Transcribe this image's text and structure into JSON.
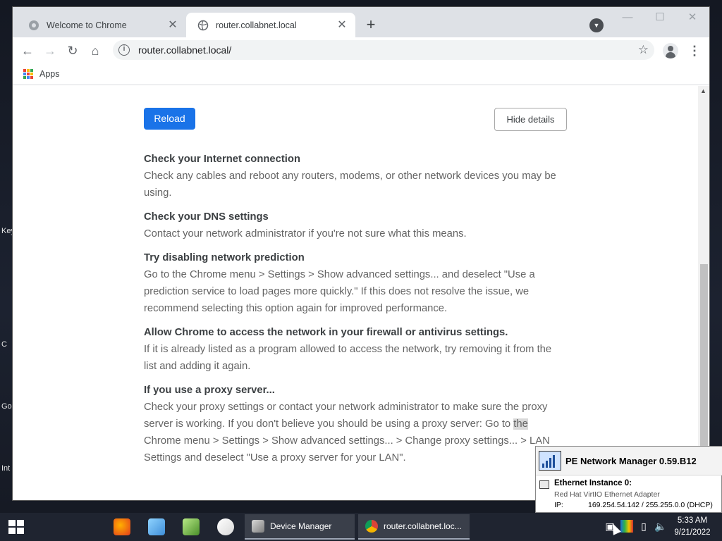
{
  "desktop": {
    "labels": [
      "Key",
      "C",
      "Go",
      "Int"
    ]
  },
  "browser": {
    "tabs": [
      {
        "label": "Welcome to Chrome",
        "active": false
      },
      {
        "label": "router.collabnet.local",
        "active": true
      }
    ],
    "address": "router.collabnet.local/",
    "bookmarks": {
      "apps_label": "Apps"
    }
  },
  "page": {
    "reload_label": "Reload",
    "hide_details_label": "Hide details",
    "suggestions": [
      {
        "heading": "Check your Internet connection",
        "body": "Check any cables and reboot any routers, modems, or other network devices you may be using."
      },
      {
        "heading": "Check your DNS settings",
        "body": "Contact your network administrator if you're not sure what this means."
      },
      {
        "heading": "Try disabling network prediction",
        "body": "Go to the Chrome menu > Settings > Show advanced settings... and deselect \"Use a prediction service to load pages more quickly.\" If this does not resolve the issue, we recommend selecting this option again for improved performance."
      },
      {
        "heading": "Allow Chrome to access the network in your firewall or antivirus settings.",
        "body": "If it is already listed as a program allowed to access the network, try removing it from the list and adding it again."
      },
      {
        "heading": "If you use a proxy server...",
        "body_before": "Check your proxy settings or contact your network administrator to make sure the proxy server is working. If you don't believe you should be using a proxy server: Go to ",
        "body_highlight": "the",
        "body_after": " Chrome menu > Settings > Show advanced settings... > Change proxy settings... > LAN Settings and deselect \"Use a proxy server for your LAN\"."
      }
    ]
  },
  "network_popup": {
    "title": "PE Network Manager 0.59.B12",
    "instance": "Ethernet Instance 0:",
    "adapter": "Red Hat VirtIO Ethernet Adapter",
    "ip_label": "IP:",
    "ip_value": "169.254.54.142  /  255.255.0.0 (DHCP)"
  },
  "taskbar": {
    "tasks": [
      {
        "label": "Device Manager"
      },
      {
        "label": "router.collabnet.loc..."
      }
    ],
    "time": "5:33 AM",
    "date": "9/21/2022"
  },
  "colors": {
    "accent": "#1a73e8",
    "apps_grid": [
      "#ea4335",
      "#fbbc04",
      "#34a853",
      "#4285f4",
      "#ea4335",
      "#fbbc04",
      "#34a853",
      "#4285f4",
      "#ea4335"
    ]
  }
}
